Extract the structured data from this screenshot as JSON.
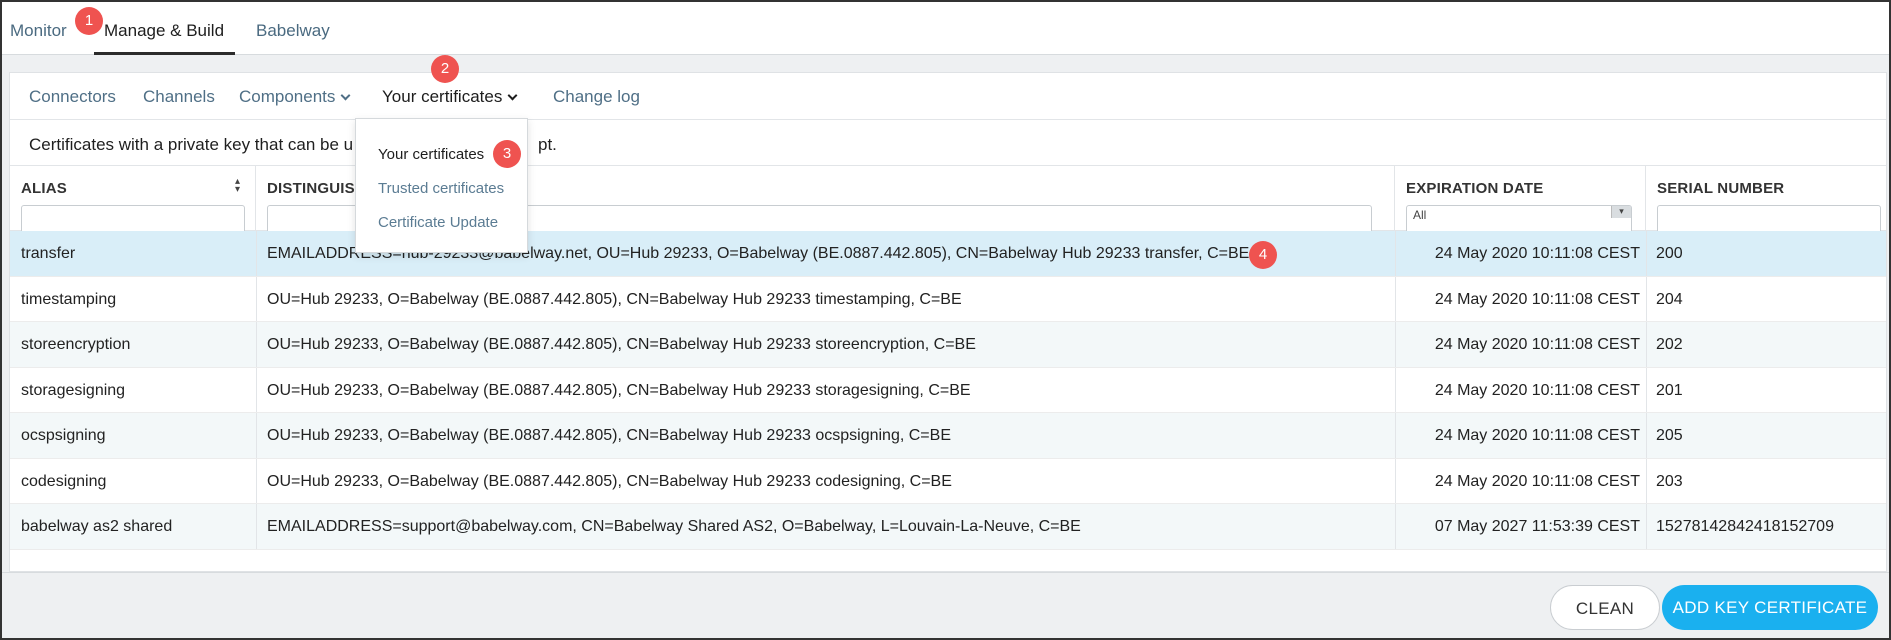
{
  "top_nav": {
    "tabs": [
      {
        "label": "Monitor"
      },
      {
        "label": "Manage & Build"
      },
      {
        "label": "Babelway"
      }
    ]
  },
  "sub_nav": {
    "items": [
      {
        "label": "Connectors"
      },
      {
        "label": "Channels"
      },
      {
        "label": "Components"
      },
      {
        "label": "Your certificates"
      },
      {
        "label": "Change log"
      }
    ]
  },
  "description": {
    "left": "Certificates with a private key that can be u",
    "right": "pt."
  },
  "dropdown": {
    "items": [
      {
        "label": "Your certificates"
      },
      {
        "label": "Trusted certificates"
      },
      {
        "label": "Certificate Update"
      }
    ]
  },
  "table": {
    "columns": [
      {
        "label": "ALIAS"
      },
      {
        "label": "DISTINGUISHED NAME",
        "visible_label": "DISTINGUISI"
      },
      {
        "label": "EXPIRATION DATE",
        "filter_value": "All"
      },
      {
        "label": "SERIAL NUMBER"
      }
    ],
    "rows": [
      {
        "alias": "transfer",
        "dn": "EMAILADDRESS=hub-29233@babelway.net, OU=Hub 29233, O=Babelway (BE.0887.442.805), CN=Babelway Hub 29233 transfer, C=BE",
        "expiration": "24 May 2020 10:11:08 CEST",
        "serial": "200"
      },
      {
        "alias": "timestamping",
        "dn": "OU=Hub 29233, O=Babelway (BE.0887.442.805), CN=Babelway Hub 29233 timestamping, C=BE",
        "expiration": "24 May 2020 10:11:08 CEST",
        "serial": "204"
      },
      {
        "alias": "storeencryption",
        "dn": "OU=Hub 29233, O=Babelway (BE.0887.442.805), CN=Babelway Hub 29233 storeencryption, C=BE",
        "expiration": "24 May 2020 10:11:08 CEST",
        "serial": "202"
      },
      {
        "alias": "storagesigning",
        "dn": "OU=Hub 29233, O=Babelway (BE.0887.442.805), CN=Babelway Hub 29233 storagesigning, C=BE",
        "expiration": "24 May 2020 10:11:08 CEST",
        "serial": "201"
      },
      {
        "alias": "ocspsigning",
        "dn": "OU=Hub 29233, O=Babelway (BE.0887.442.805), CN=Babelway Hub 29233 ocspsigning, C=BE",
        "expiration": "24 May 2020 10:11:08 CEST",
        "serial": "205"
      },
      {
        "alias": "codesigning",
        "dn": "OU=Hub 29233, O=Babelway (BE.0887.442.805), CN=Babelway Hub 29233 codesigning, C=BE",
        "expiration": "24 May 2020 10:11:08 CEST",
        "serial": "203"
      },
      {
        "alias": "babelway as2 shared",
        "dn": "EMAILADDRESS=support@babelway.com, CN=Babelway Shared AS2, O=Babelway, L=Louvain-La-Neuve, C=BE",
        "expiration": "07 May 2027 11:53:39 CEST",
        "serial": "15278142842418152709"
      }
    ]
  },
  "footer": {
    "clean_label": "CLEAN",
    "add_label": "ADD KEY CERTIFICATE"
  },
  "annotations": [
    "1",
    "2",
    "3",
    "4"
  ],
  "colors": {
    "accent": "#1ab0ef",
    "badge": "#ef5350",
    "selected_row": "#d9eef8",
    "alt_row": "#f3f8f9"
  }
}
